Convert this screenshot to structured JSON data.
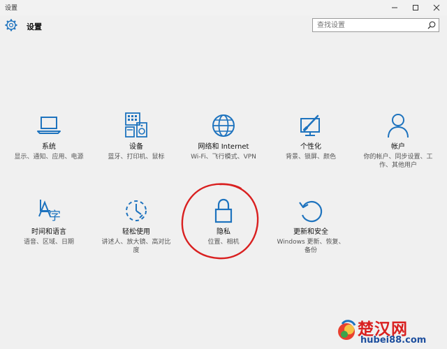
{
  "window": {
    "title": "设置"
  },
  "header": {
    "title": "设置"
  },
  "search": {
    "placeholder": "查找设置"
  },
  "tiles": [
    {
      "label": "系统",
      "desc": "显示、通知、应用、电源",
      "icon": "laptop-icon"
    },
    {
      "label": "设备",
      "desc": "蓝牙、打印机、鼠标",
      "icon": "devices-icon"
    },
    {
      "label": "网络和 Internet",
      "desc": "Wi-Fi、飞行模式、VPN",
      "icon": "globe-icon"
    },
    {
      "label": "个性化",
      "desc": "背景、锁屏、颜色",
      "icon": "personalization-icon"
    },
    {
      "label": "帐户",
      "desc": "你的帐户、同步设置、工作、其他用户",
      "icon": "person-icon"
    },
    {
      "label": "时间和语言",
      "desc": "语音、区域、日期",
      "icon": "time-language-icon"
    },
    {
      "label": "轻松使用",
      "desc": "讲述人、放大镜、高对比度",
      "icon": "ease-of-access-icon"
    },
    {
      "label": "隐私",
      "desc": "位置、相机",
      "icon": "lock-icon"
    },
    {
      "label": "更新和安全",
      "desc": "Windows 更新、恢复、备份",
      "icon": "update-icon"
    }
  ],
  "watermark": {
    "brand": "楚汉网",
    "url": "hubei88.com"
  },
  "colors": {
    "accent": "#1e73be",
    "annotation": "#d92020"
  }
}
